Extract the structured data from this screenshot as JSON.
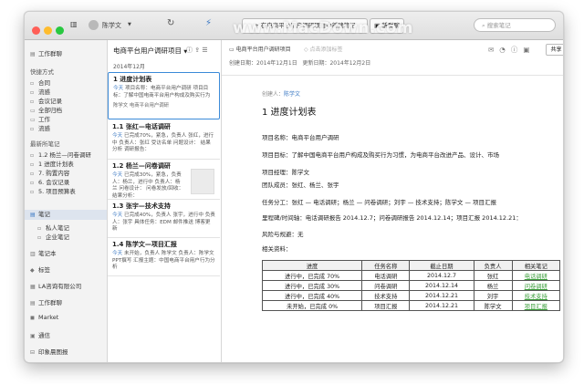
{
  "watermark": "www.MacDown.com",
  "titlebar": {
    "user_name": "陈学文",
    "new_note_label": "在电商平台用户调研项目中新建笔记",
    "new_chat_label": "新群聊",
    "search_placeholder": "搜索笔记"
  },
  "sidebar": {
    "workbench": "工作群聊",
    "shortcuts_header": "快捷方式",
    "shortcuts": [
      "合同",
      "流感",
      "会议记录",
      "全部归档",
      "工作",
      "流感"
    ],
    "recent_header": "最新所笔记",
    "recent": [
      "1.2 杨兰—问卷调研",
      "1 进度计划表",
      "7. 购置内容",
      "6. 会议记录",
      "5. 项目预算表"
    ],
    "notes_label": "笔记",
    "private_notes": "私人笔记",
    "company_notes": "企业笔记",
    "notebooks": "笔记本",
    "tags": "标签",
    "la_company": "LA咨询有限公司",
    "workchat": "工作群聊",
    "market": "Market",
    "directory": "通信",
    "wechat_clips": "印象晨图报"
  },
  "notelist": {
    "title": "电商平台用户调研项目",
    "date_header": "2014年12月",
    "cards": [
      {
        "title": "1 进度计划表",
        "hl": "今天",
        "body": " 项目名称：电商平台用户调研 项目目标：了解中国电商平台用户构成及购买行为",
        "foot": "陈学文          电商平台用户调研"
      },
      {
        "title": "1.1 张红—电话调研",
        "hl": "今天",
        "body": " 已完成70%，紧急，负责人 张红，进行中 负责人：张红 受访名单   问题设计：  结果分析 调研报告：",
        "foot": ""
      },
      {
        "title": "1.2 杨兰—问卷调研",
        "hl": "今天",
        "body": " 已完成30%，紧急，负责人：杨兰，进行中 负责人：杨兰   问卷设计：  问卷发放/回收：  结果分析：",
        "foot": "样本量：20,000 问卷设计："
      },
      {
        "title": "1.3 张宇—技术支持",
        "hl": "今天",
        "body": " 已完成40%，负责人 张宇，进行中 负责人：张宇 具体任务：EDM 邮件推送 博客更新",
        "foot": ""
      },
      {
        "title": "1.4 陈学文—项目汇报",
        "hl": "今天",
        "body": " 未开始，负责人 陈学文 负责人：陈学文 PPT撰写 汇报主题：中国电商平台用户行为分析",
        "foot": ""
      }
    ]
  },
  "editor": {
    "path": "电商平台用户调研项目",
    "tag_placeholder": "点击添加标签",
    "created": "创建日期：2014年12月1日",
    "updated": "更新日期：2014年12月2日",
    "share_label": "共享",
    "creator_label": "创建人：",
    "creator_name": "陈学文",
    "doc_title": "1 进度计划表",
    "lines": [
      "项目名称：电商平台用户调研",
      "项目目标：了解中国电商平台用户构成及购买行为习惯，为电商平台改进产品、设计、市场",
      "项目经理：陈学文",
      "团队成员：张红、杨兰、张宇",
      "任务分工：张红 — 电话调研；杨兰 — 问卷调研；刘宇 — 技术支持；陈学文 — 项目汇报",
      "里程碑/时间轴：电话调研报告 2014.12.7；问卷调研报告 2014.12.14；项目汇报 2014.12.21：",
      "风险与规避：无",
      "相关资料："
    ],
    "table": {
      "headers": [
        "进度",
        "任务名称",
        "截止日期",
        "负责人",
        "相关笔记"
      ],
      "rows": [
        [
          "进行中，已完成 70%",
          "电话调研",
          "2014.12.7",
          "张红",
          "电话调研"
        ],
        [
          "进行中，已完成 30%",
          "问卷调研",
          "2014.12.14",
          "杨兰",
          "问卷调研"
        ],
        [
          "进行中，已完成 40%",
          "技术支持",
          "2014.12.21",
          "刘宇",
          "技术支持"
        ],
        [
          "未开始，已完成 0%",
          "项目汇报",
          "2014.12.21",
          "陈学文",
          "项目汇报"
        ]
      ]
    }
  }
}
